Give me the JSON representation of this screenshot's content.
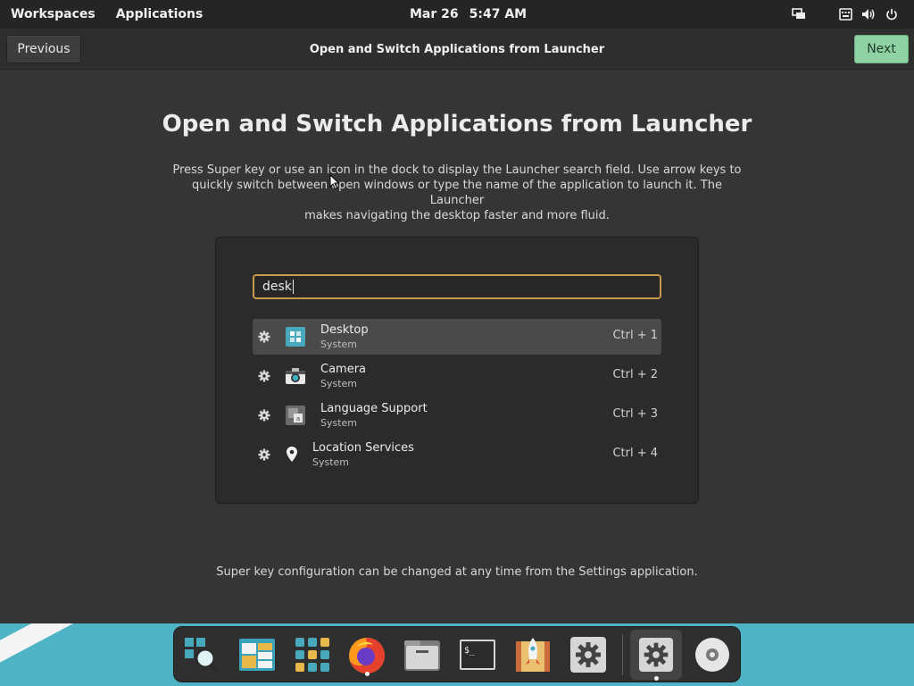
{
  "topbar": {
    "workspaces": "Workspaces",
    "applications": "Applications",
    "date": "Mar 26",
    "time": "5:47 AM",
    "indicators": [
      "display-icon",
      "keyboard-icon",
      "volume-icon",
      "power-icon"
    ]
  },
  "header": {
    "previous_label": "Previous",
    "title": "Open and Switch Applications from Launcher",
    "next_label": "Next"
  },
  "main": {
    "title": "Open and Switch Applications from Launcher",
    "description_lines": [
      "Press Super key or use an icon in the dock to display the Launcher search field. Use arrow keys to",
      "quickly switch between open windows or type the name of the application to launch it. The Launcher",
      "makes navigating the desktop faster and more fluid."
    ],
    "search_value": "desk",
    "results": [
      {
        "name": "Desktop",
        "category": "System",
        "shortcut": "Ctrl + 1",
        "icon": "desktop-settings-icon",
        "selected": true
      },
      {
        "name": "Camera",
        "category": "System",
        "shortcut": "Ctrl + 2",
        "icon": "camera-icon",
        "selected": false
      },
      {
        "name": "Language Support",
        "category": "System",
        "shortcut": "Ctrl + 3",
        "icon": "language-icon",
        "selected": false
      },
      {
        "name": "Location Services",
        "category": "System",
        "shortcut": "Ctrl + 4",
        "icon": "location-pin-icon",
        "selected": false
      }
    ],
    "footnote": "Super key configuration can be changed at any time from the Settings application."
  },
  "dock": {
    "items": [
      "launcher-search-icon",
      "files-window-icon",
      "app-grid-icon",
      "firefox-icon",
      "file-manager-icon",
      "terminal-icon",
      "pop-shop-icon",
      "settings-icon",
      "settings-active-icon",
      "disc-icon"
    ]
  },
  "colors": {
    "accent_next": "#8fd3a5",
    "search_border": "#c89a4a",
    "wallpaper": "#4fb3c6"
  }
}
